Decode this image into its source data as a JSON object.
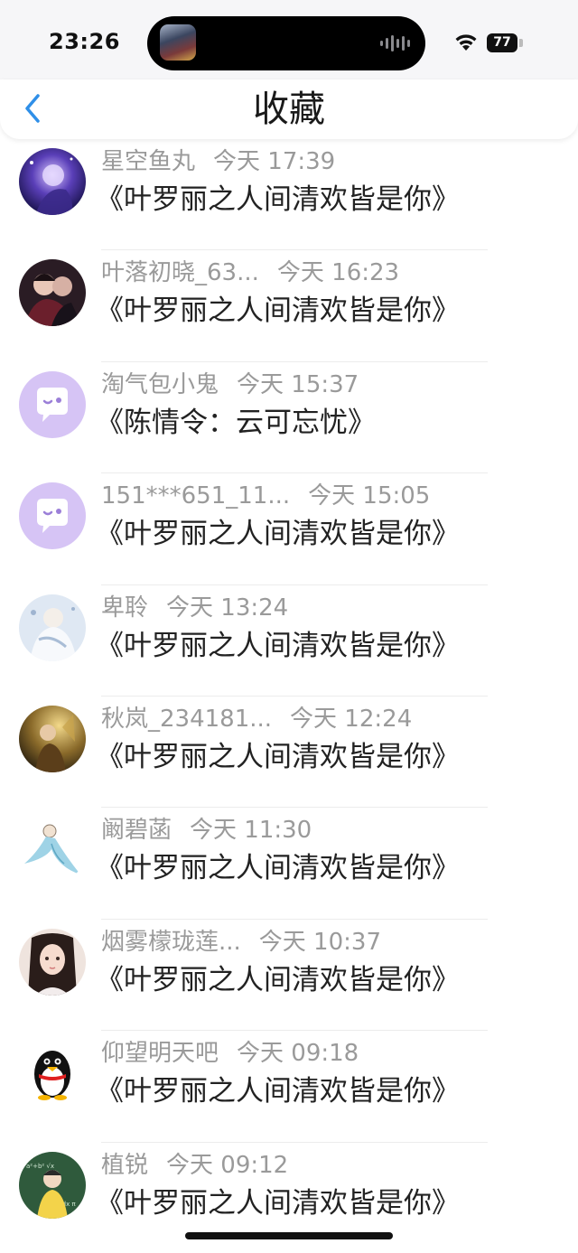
{
  "status_bar": {
    "time": "23:26",
    "battery": "77",
    "wifi_icon": "wifi-icon"
  },
  "nav": {
    "title": "收藏",
    "back_icon": "chevron-left-icon",
    "accent_color": "#2f8fe8"
  },
  "items": [
    {
      "name": "星空鱼丸",
      "time": "今天 17:39",
      "book": "《叶罗丽之人间清欢皆是你》",
      "avatar": "anime-avatar-purple"
    },
    {
      "name": "叶落初晓_63...",
      "time": "今天 16:23",
      "book": "《叶罗丽之人间清欢皆是你》",
      "avatar": "anime-avatar-couple"
    },
    {
      "name": "淘气包小鬼",
      "time": "今天 15:37",
      "book": "《陈情令：云可忘忧》",
      "avatar": "default-chat-avatar"
    },
    {
      "name": "151***651_11...",
      "time": "今天 15:05",
      "book": "《叶罗丽之人间清欢皆是你》",
      "avatar": "default-chat-avatar"
    },
    {
      "name": "卑聆",
      "time": "今天 13:24",
      "book": "《叶罗丽之人间清欢皆是你》",
      "avatar": "anime-avatar-white"
    },
    {
      "name": "秋岚_234181...",
      "time": "今天 12:24",
      "book": "《叶罗丽之人间清欢皆是你》",
      "avatar": "anime-avatar-golden"
    },
    {
      "name": "阚碧菡",
      "time": "今天 11:30",
      "book": "《叶罗丽之人间清欢皆是你》",
      "avatar": "anime-avatar-dancer"
    },
    {
      "name": "烟雾檬珑莲...",
      "time": "今天 10:37",
      "book": "《叶罗丽之人间清欢皆是你》",
      "avatar": "anime-avatar-girl"
    },
    {
      "name": "仰望明天吧",
      "time": "今天 09:18",
      "book": "《叶罗丽之人间清欢皆是你》",
      "avatar": "penguin-avatar"
    },
    {
      "name": "植锐",
      "time": "今天 09:12",
      "book": "《叶罗丽之人间清欢皆是你》",
      "avatar": "anime-avatar-chalkboard"
    }
  ]
}
